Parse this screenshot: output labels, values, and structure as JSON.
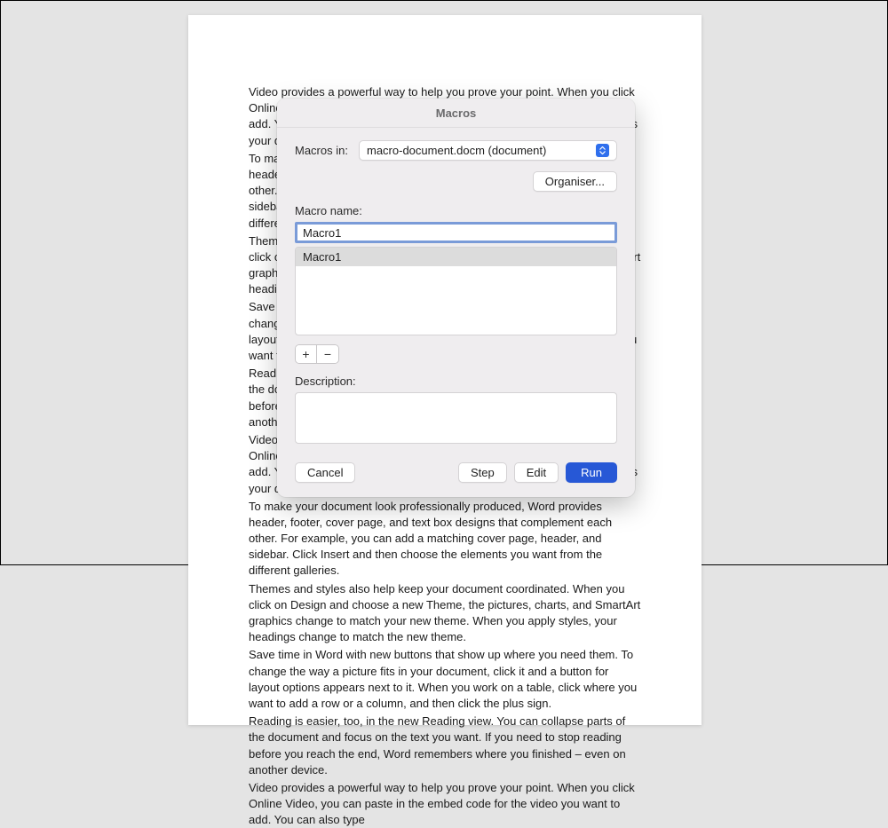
{
  "document": {
    "paragraphs": [
      "Video provides a powerful way to help you prove your point. When you click Online Video, you can paste in the embed code for the video you want to add. You can also type a keyword to search online for the video that best fits your document.",
      "To make your document look professionally produced, Word provides header, footer, cover page, and text box designs that complement each other. For example, you can add a matching cover page, header, and sidebar. Click Insert and then choose the elements you want from the different galleries.",
      "Themes and styles also help keep your document coordinated. When you click on Design and choose a new Theme, the pictures, charts, and SmartArt graphics change to match your new theme. When you apply styles, your headings change to match the new theme.",
      "Save time in Word with new buttons that show up where you need them. To change the way a picture fits in your document, click it and a button for layout options appears next to it. When you work on a table, click where you want to add a row or a column, and then click the plus sign.",
      "Reading is easier, too, in the new Reading view. You can collapse parts of the document and focus on the text you want. If you need to stop reading before you reach the end, Word remembers where you finished – even on another device.",
      "Video provides a powerful way to help you prove your point. When you click Online Video, you can paste in the embed code for the video you want to add. You can also type a keyword to search online for the video that best fits your document.",
      "To make your document look professionally produced, Word provides header, footer, cover page, and text box designs that complement each other. For example, you can add a matching cover page, header, and sidebar. Click Insert and then choose the elements you want from the different galleries.",
      "Themes and styles also help keep your document coordinated. When you click on Design and choose a new Theme, the pictures, charts, and SmartArt graphics change to match your new theme. When you apply styles, your headings change to match the new theme.",
      "Save time in Word with new buttons that show up where you need them. To change the way a picture fits in your document, click it and a button for layout options appears next to it. When you work on a table, click where you want to add a row or a column, and then click the plus sign.",
      "Reading is easier, too, in the new Reading view. You can collapse parts of the document and focus on the text you want. If you need to stop reading before you reach the end, Word remembers where you finished – even on another device.",
      "Video provides a powerful way to help you prove your point. When you click Online Video, you can paste in the embed code for the video you want to add. You can also type"
    ]
  },
  "dialog": {
    "title": "Macros",
    "macros_in_label": "Macros in:",
    "macros_in_value": "macro-document.docm (document)",
    "organiser_label": "Organiser...",
    "macro_name_label": "Macro name:",
    "macro_name_value": "Macro1",
    "macro_list": [
      "Macro1"
    ],
    "plus_label": "+",
    "minus_label": "−",
    "description_label": "Description:",
    "description_value": "",
    "cancel_label": "Cancel",
    "step_label": "Step",
    "edit_label": "Edit",
    "run_label": "Run"
  }
}
